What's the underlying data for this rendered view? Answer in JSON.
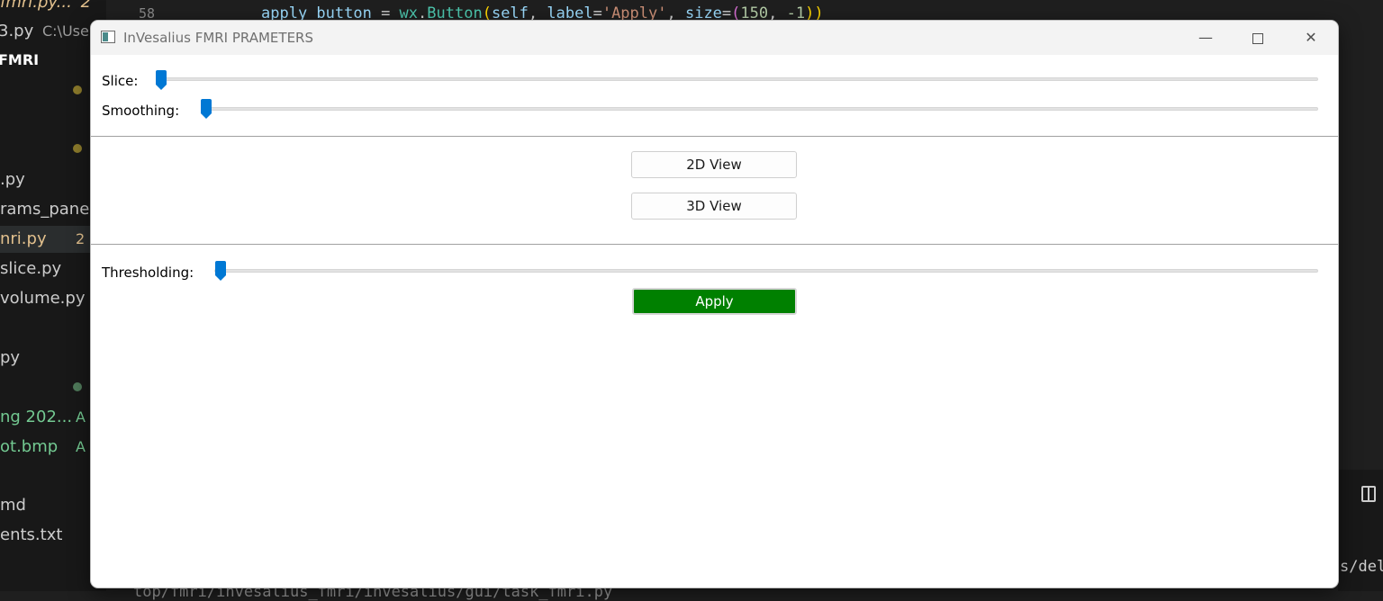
{
  "background": {
    "explorer": {
      "files": [
        {
          "label": "fmri.py...",
          "badge": "2",
          "color": "#e2c08d"
        },
        {
          "label": "3.py",
          "extra": "C:\\Users",
          "color": "#cccccc"
        },
        {
          "label": "FMRI",
          "color": "#ffffff"
        },
        {
          "label": ".py",
          "color": "#cccccc"
        },
        {
          "label": "rams_panel.",
          "color": "#cccccc"
        },
        {
          "label": "nri.py",
          "badge": "2",
          "color": "#e2c08d"
        },
        {
          "label": "slice.py",
          "color": "#cccccc"
        },
        {
          "label": "volume.py",
          "color": "#cccccc"
        },
        {
          "label": "py",
          "color": "#cccccc"
        },
        {
          "label": "ng 202...",
          "badge": "A",
          "color": "#73c991"
        },
        {
          "label": "ot.bmp",
          "badge": "A",
          "color": "#73c991"
        },
        {
          "label": "md",
          "color": "#cccccc"
        },
        {
          "label": "ents.txt",
          "color": "#cccccc"
        }
      ]
    },
    "editor": {
      "line_number": "58",
      "code": {
        "var": "apply_button",
        "eq": " = ",
        "module": "wx",
        "dot": ".",
        "cls": "Button",
        "open": "(",
        "self": "self",
        "comma1": ", ",
        "kw1": "label",
        "eq1": "=",
        "str": "'Apply'",
        "comma2": ", ",
        "kw2": "size",
        "eq2": "=",
        "open2": "(",
        "n1": "150",
        "comma3": ", ",
        "n2": "-1",
        "close": "))"
      }
    },
    "terminal": {
      "right_text": "s/del",
      "bottom_text": "top/fmri/invesalius_fmri/invesalius/gui/task_fmri.py"
    }
  },
  "window": {
    "title": "InVesalius FMRI PRAMETERS",
    "controls": {
      "minimize": "—",
      "close": "✕"
    },
    "sliders": [
      {
        "label": "Slice:",
        "value": 0
      },
      {
        "label": "Smoothing:",
        "value": 0
      },
      {
        "label": "Thresholding:",
        "value": 0
      }
    ],
    "buttons": {
      "view2d": "2D View",
      "view3d": "3D View",
      "apply": "Apply"
    },
    "colors": {
      "accent": "#0078d4",
      "apply_bg": "#008000"
    }
  }
}
